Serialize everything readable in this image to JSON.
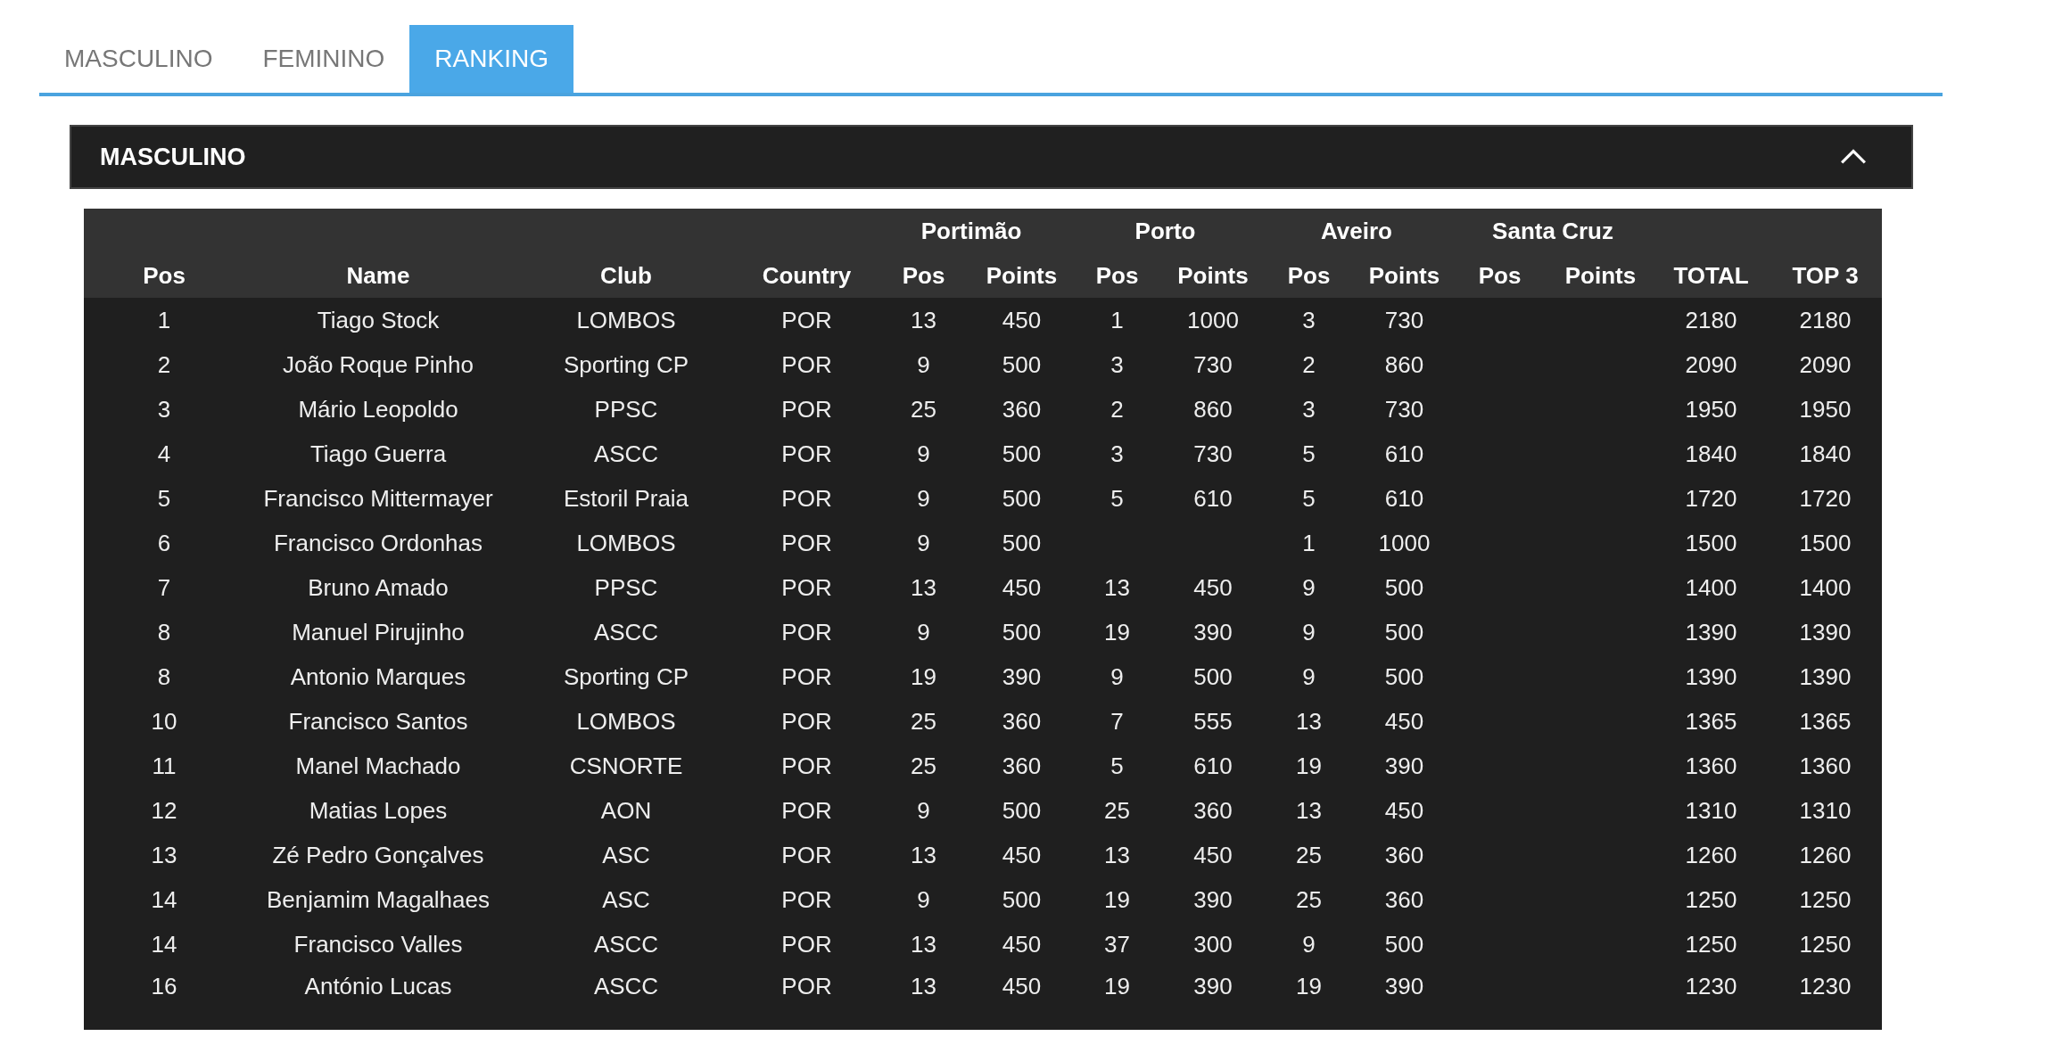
{
  "tabs": [
    {
      "label": "MASCULINO",
      "selected": false
    },
    {
      "label": "FEMININO",
      "selected": false
    },
    {
      "label": "RANKING",
      "selected": true
    }
  ],
  "panel": {
    "title": "MASCULINO",
    "expanded": true
  },
  "table": {
    "groups": [
      "Portimão",
      "Porto",
      "Aveiro",
      "Santa Cruz"
    ],
    "columns": [
      "Pos",
      "Name",
      "Club",
      "Country",
      "Pos",
      "Points",
      "Pos",
      "Points",
      "Pos",
      "Points",
      "Pos",
      "Points",
      "TOTAL",
      "TOP 3"
    ],
    "rows": [
      [
        "1",
        "Tiago Stock",
        "LOMBOS",
        "POR",
        "13",
        "450",
        "1",
        "1000",
        "3",
        "730",
        null,
        null,
        "2180",
        "2180"
      ],
      [
        "2",
        "João Roque Pinho",
        "Sporting CP",
        "POR",
        "9",
        "500",
        "3",
        "730",
        "2",
        "860",
        null,
        null,
        "2090",
        "2090"
      ],
      [
        "3",
        "Mário Leopoldo",
        "PPSC",
        "POR",
        "25",
        "360",
        "2",
        "860",
        "3",
        "730",
        null,
        null,
        "1950",
        "1950"
      ],
      [
        "4",
        "Tiago Guerra",
        "ASCC",
        "POR",
        "9",
        "500",
        "3",
        "730",
        "5",
        "610",
        null,
        null,
        "1840",
        "1840"
      ],
      [
        "5",
        "Francisco Mittermayer",
        "Estoril Praia",
        "POR",
        "9",
        "500",
        "5",
        "610",
        "5",
        "610",
        null,
        null,
        "1720",
        "1720"
      ],
      [
        "6",
        "Francisco Ordonhas",
        "LOMBOS",
        "POR",
        "9",
        "500",
        null,
        null,
        "1",
        "1000",
        null,
        null,
        "1500",
        "1500"
      ],
      [
        "7",
        "Bruno Amado",
        "PPSC",
        "POR",
        "13",
        "450",
        "13",
        "450",
        "9",
        "500",
        null,
        null,
        "1400",
        "1400"
      ],
      [
        "8",
        "Manuel Pirujinho",
        "ASCC",
        "POR",
        "9",
        "500",
        "19",
        "390",
        "9",
        "500",
        null,
        null,
        "1390",
        "1390"
      ],
      [
        "8",
        "Antonio Marques",
        "Sporting CP",
        "POR",
        "19",
        "390",
        "9",
        "500",
        "9",
        "500",
        null,
        null,
        "1390",
        "1390"
      ],
      [
        "10",
        "Francisco Santos",
        "LOMBOS",
        "POR",
        "25",
        "360",
        "7",
        "555",
        "13",
        "450",
        null,
        null,
        "1365",
        "1365"
      ],
      [
        "11",
        "Manel Machado",
        "CSNORTE",
        "POR",
        "25",
        "360",
        "5",
        "610",
        "19",
        "390",
        null,
        null,
        "1360",
        "1360"
      ],
      [
        "12",
        "Matias Lopes",
        "AON",
        "POR",
        "9",
        "500",
        "25",
        "360",
        "13",
        "450",
        null,
        null,
        "1310",
        "1310"
      ],
      [
        "13",
        "Zé Pedro Gonçalves",
        "ASC",
        "POR",
        "13",
        "450",
        "13",
        "450",
        "25",
        "360",
        null,
        null,
        "1260",
        "1260"
      ],
      [
        "14",
        "Benjamim Magalhaes",
        "ASC",
        "POR",
        "9",
        "500",
        "19",
        "390",
        "25",
        "360",
        null,
        null,
        "1250",
        "1250"
      ],
      [
        "14",
        "Francisco Valles",
        "ASCC",
        "POR",
        "13",
        "450",
        "37",
        "300",
        "9",
        "500",
        null,
        null,
        "1250",
        "1250"
      ],
      [
        "16",
        "António Lucas",
        "ASCC",
        "POR",
        "13",
        "450",
        "19",
        "390",
        "19",
        "390",
        null,
        null,
        "1230",
        "1230"
      ]
    ]
  }
}
